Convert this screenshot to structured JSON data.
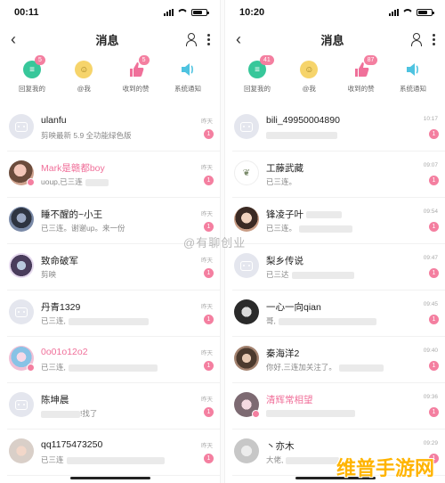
{
  "phones": [
    {
      "status": {
        "time": "00:11"
      },
      "nav": {
        "title": "消息"
      },
      "quick": [
        {
          "label": "回复我的",
          "badge": "5",
          "icon": "reply-bubble-icon"
        },
        {
          "label": "@我",
          "badge": "",
          "icon": "at-icon"
        },
        {
          "label": "收到的赞",
          "badge": "5",
          "icon": "thumbs-up-icon"
        },
        {
          "label": "系统通知",
          "badge": "",
          "icon": "speaker-icon"
        }
      ],
      "rows": [
        {
          "name": "ulanfu",
          "msg": "剪映最新 5.9 全功能绿色版",
          "time": "昨天",
          "count": "1"
        },
        {
          "name": "Mark是赣都boy",
          "msg": "uoup,已三连",
          "time": "昨天",
          "count": "1"
        },
        {
          "name": "睡不醒的~小王",
          "msg": "已三连。谢谢up。来一份",
          "time": "昨天",
          "count": "1"
        },
        {
          "name": "致命破军",
          "msg": "剪映",
          "time": "昨天",
          "count": "1"
        },
        {
          "name": "丹青1329",
          "msg": "已三连,",
          "time": "昨天",
          "count": "1"
        },
        {
          "name": "0o01o12o2",
          "msg": "已三连,",
          "time": "昨天",
          "count": "1"
        },
        {
          "name": "陈坤晨",
          "msg": "",
          "msg_tail": "!找了",
          "time": "昨天",
          "count": "1"
        },
        {
          "name": "qq1175473250",
          "msg": "已三连",
          "time": "昨天",
          "count": "1"
        }
      ]
    },
    {
      "status": {
        "time": "10:20"
      },
      "nav": {
        "title": "消息"
      },
      "quick": [
        {
          "label": "回复我的",
          "badge": "41",
          "icon": "reply-bubble-icon"
        },
        {
          "label": "@我",
          "badge": "",
          "icon": "at-icon"
        },
        {
          "label": "收到的赞",
          "badge": "87",
          "icon": "thumbs-up-icon"
        },
        {
          "label": "系统通知",
          "badge": "",
          "icon": "speaker-icon"
        }
      ],
      "rows": [
        {
          "name": "bili_49950004890",
          "msg": "",
          "time": "10:17",
          "count": "1"
        },
        {
          "name": "工藤武藏",
          "msg": "已三连。",
          "time": "09:07",
          "count": "1"
        },
        {
          "name": "锋凌子叶",
          "msg": "已三连。",
          "time": "09:54",
          "count": "1"
        },
        {
          "name": "梨乡传说",
          "msg": "已三达",
          "time": "09:47",
          "count": "1"
        },
        {
          "name": "一心一向qian",
          "msg": "哥,",
          "time": "09:45",
          "count": "1"
        },
        {
          "name": "秦海洋2",
          "msg": "你好,三连加关注了。",
          "time": "09:40",
          "count": "1"
        },
        {
          "name": "清辉常相望",
          "msg": "",
          "time": "09:36",
          "count": "1"
        },
        {
          "name": "丶亦木",
          "msg": "大佬,",
          "time": "09:29",
          "count": "1"
        }
      ]
    }
  ],
  "watermarks": {
    "center": "@有聊创业",
    "corner": "维普手游网"
  },
  "colors": {
    "pink": "#f47fa0",
    "green": "#37c79a",
    "yellow": "#f6d46b",
    "blue": "#4ec3e0",
    "likered": "#f0709a"
  }
}
